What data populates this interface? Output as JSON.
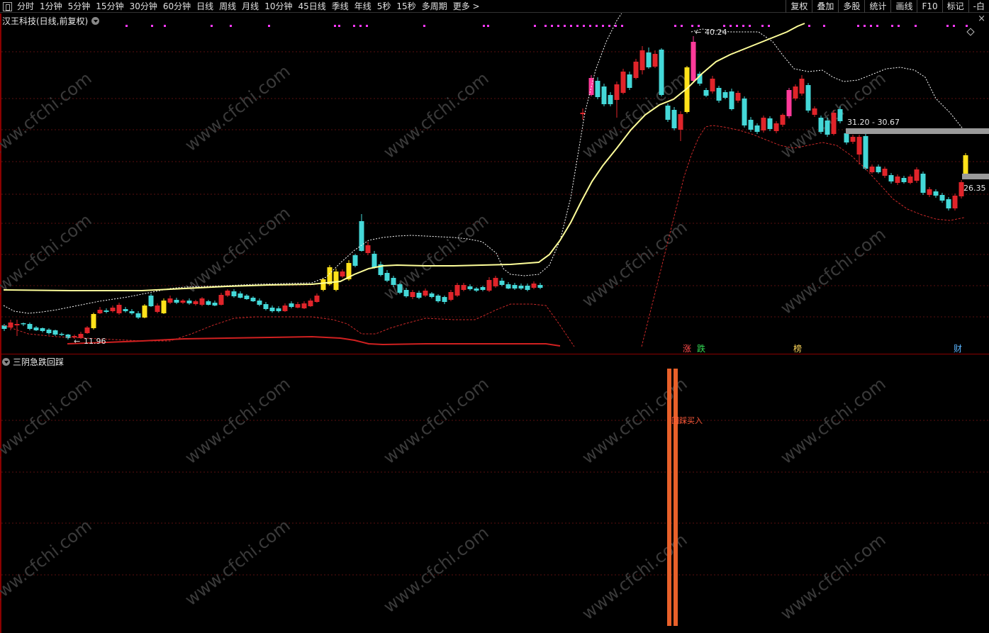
{
  "toolbar": {
    "periods": [
      "分时",
      "1分钟",
      "5分钟",
      "15分钟",
      "30分钟",
      "60分钟",
      "日线",
      "周线",
      "月线",
      "10分钟",
      "45日线",
      "季线",
      "年线",
      "5秒",
      "15秒",
      "多周期",
      "更多 >"
    ],
    "right_items": [
      "复权",
      "叠加",
      "多股",
      "统计",
      "画线",
      "F10",
      "标记",
      "-白"
    ]
  },
  "main_pane": {
    "title": "汉王科技(日线,前复权)",
    "labels": {
      "high": "40.24",
      "low": "11.96",
      "range": "31.20 - 30.67",
      "last": "26.35"
    },
    "markers": [
      {
        "text": "涨",
        "color": "#ff4a4a"
      },
      {
        "text": "跌",
        "color": "#33dd55"
      },
      {
        "text": "榜",
        "color": "#ffd75a"
      },
      {
        "text": "财",
        "color": "#5ab4ff"
      }
    ],
    "colors": {
      "up": "#e0242a",
      "down": "#44d8d8",
      "limit_up": "#ffe21a",
      "limit_up_special": "#ff3a9a",
      "ma_line": "#ffff9a",
      "band": "#ffffff",
      "lower_band": "#c82828",
      "grid": "#5a1010"
    }
  },
  "sub_pane": {
    "title": "三阴急跌回踩",
    "signal_text": "回踩买入",
    "bar_color": "#e8602a"
  },
  "watermark": "www.cfchi.com"
}
